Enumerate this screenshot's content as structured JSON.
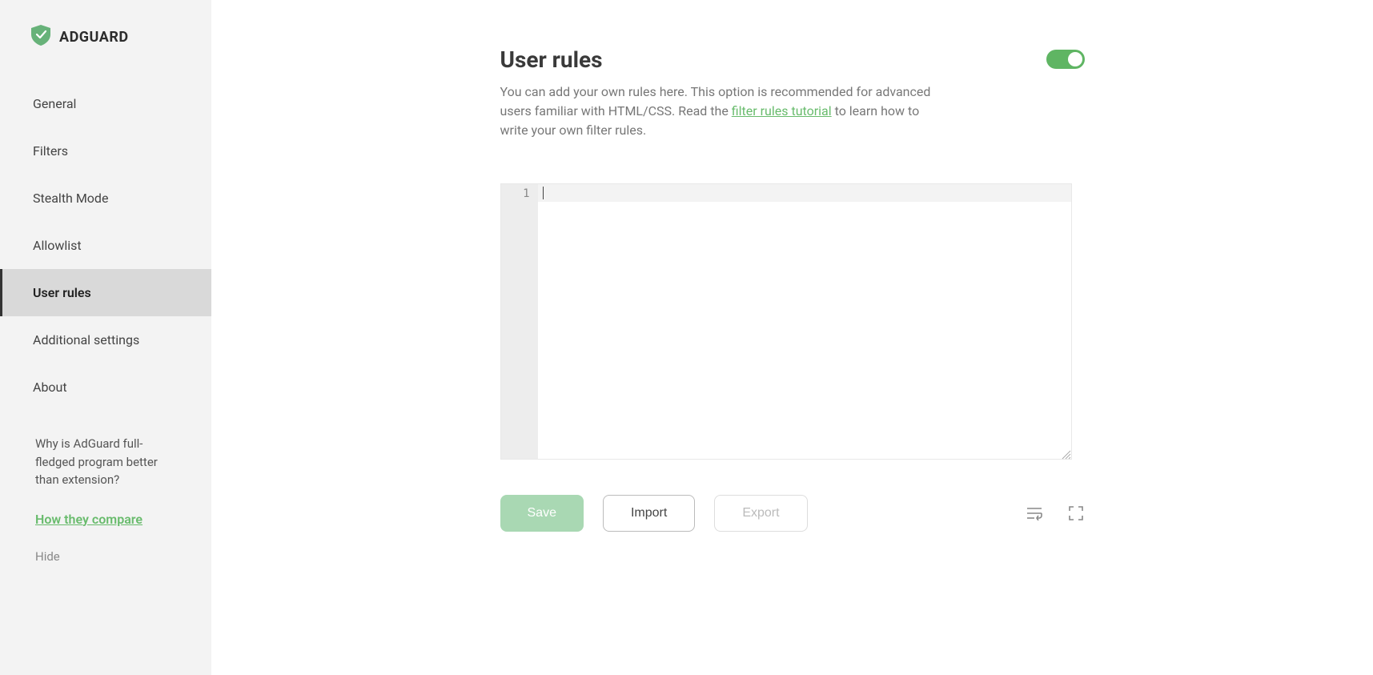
{
  "app": {
    "name": "ADGUARD"
  },
  "sidebar": {
    "items": [
      {
        "label": "General"
      },
      {
        "label": "Filters"
      },
      {
        "label": "Stealth Mode"
      },
      {
        "label": "Allowlist"
      },
      {
        "label": "User rules"
      },
      {
        "label": "Additional settings"
      },
      {
        "label": "About"
      }
    ],
    "activeIndex": 4,
    "promo": {
      "question": "Why is AdGuard full-fledged program better than extension?",
      "compare_link": "How they compare",
      "hide": "Hide"
    }
  },
  "page": {
    "title": "User rules",
    "desc_before": "You can add your own rules here. This option is recommended for advanced users familiar with HTML/CSS. Read the ",
    "desc_link": "filter rules tutorial",
    "desc_after": " to learn how to write your own filter rules.",
    "toggle_on": true
  },
  "editor": {
    "line_numbers": [
      "1"
    ],
    "content": ""
  },
  "actions": {
    "save": "Save",
    "import": "Import",
    "export": "Export"
  }
}
